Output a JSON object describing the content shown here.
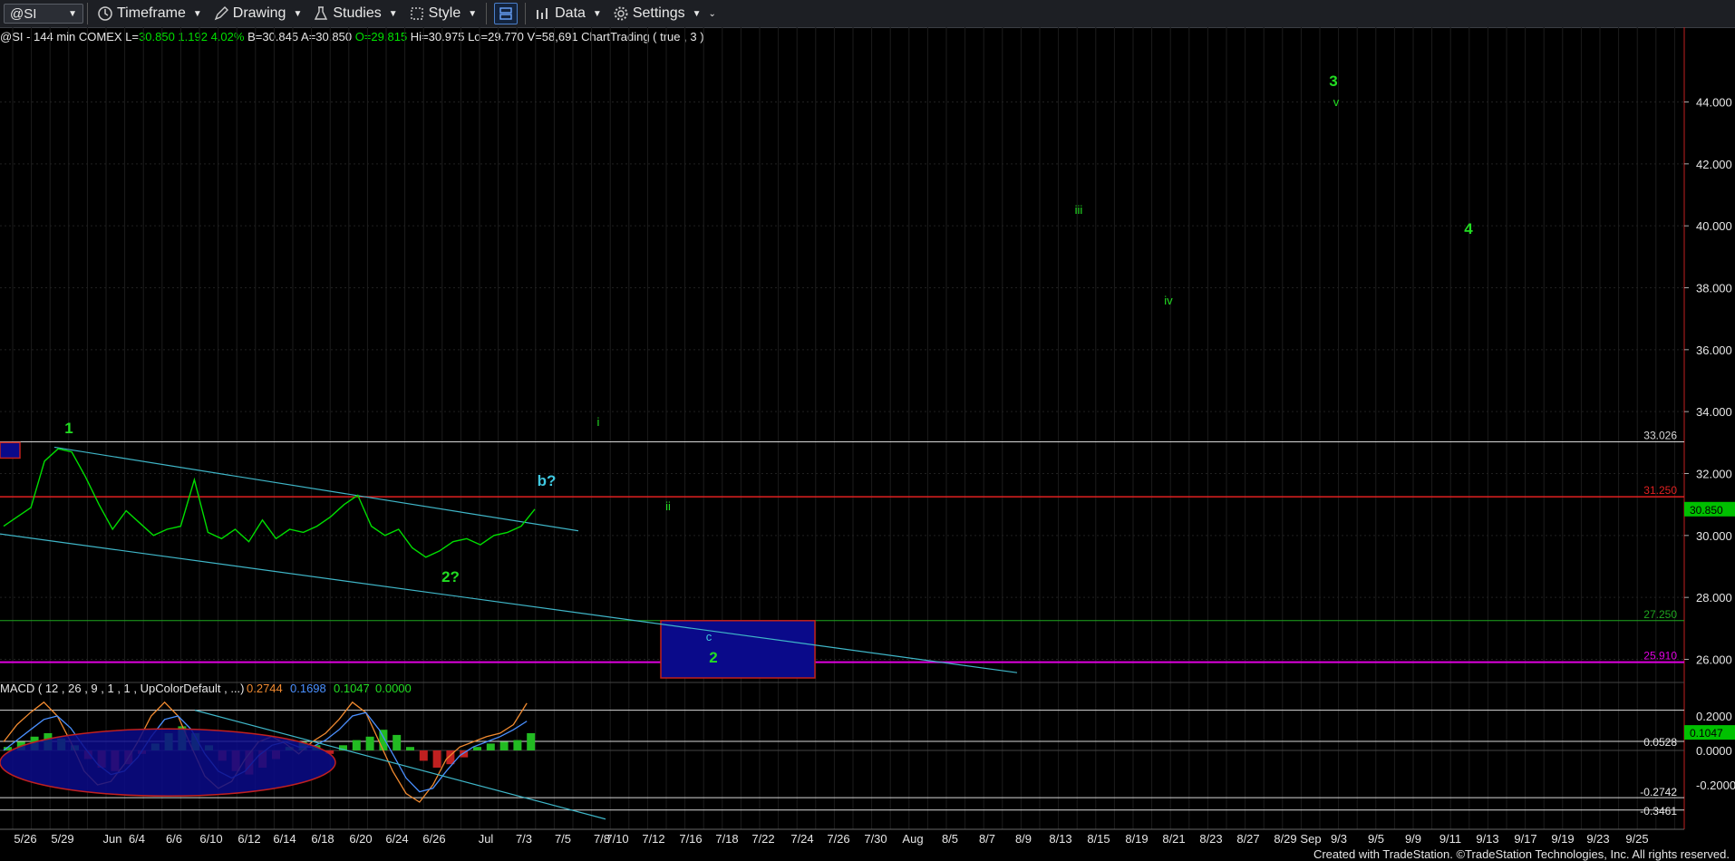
{
  "toolbar": {
    "symbol": "@SI",
    "timeframe": "Timeframe",
    "drawing": "Drawing",
    "studies": "Studies",
    "style": "Style",
    "data": "Data",
    "settings": "Settings"
  },
  "infobar": {
    "symbol_desc": "@SI - 144 min COMEX",
    "last_label": "L=",
    "last_value": "30.850",
    "change": "1.192",
    "change_pct": "4.02%",
    "bid_label": "B=",
    "bid_value": "30.845",
    "ask_label": "A=",
    "ask_value": "30.850",
    "open_label": "O=",
    "open_value": "29.815",
    "high_label": "Hi=",
    "high_value": "30.975",
    "low_label": "Lo=",
    "low_value": "29.770",
    "volume_label": "V=",
    "volume_value": "58,691",
    "extra": "ChartTrading ( true , 3 )"
  },
  "colors": {
    "price": "#00dd00",
    "trendline": "#3fb6c8",
    "red_line": "#e02020",
    "green_line": "#1fa51f",
    "magenta_line": "#e000e0",
    "white_line": "#d8d8d8",
    "box_fill": "#0a0a8a",
    "box_border": "#c0201a",
    "wave_green": "#22dd22",
    "wave_cyan": "#3fc8e0"
  },
  "chart_data": {
    "type": "line",
    "y_axis_ticks": [
      "44.000",
      "42.000",
      "40.000",
      "38.000",
      "36.000",
      "34.000",
      "32.000",
      "30.000",
      "28.000",
      "26.000"
    ],
    "x_axis_ticks": [
      "5/26",
      "5/29",
      "Jun",
      "6/4",
      "6/6",
      "6/10",
      "6/12",
      "6/14",
      "6/18",
      "6/20",
      "6/24",
      "6/26",
      "Jul",
      "7/3",
      "7/5",
      "7/8",
      "7/10",
      "7/12",
      "7/16",
      "7/18",
      "7/22",
      "7/24",
      "7/26",
      "7/30",
      "Aug",
      "8/5",
      "8/7",
      "8/9",
      "8/13",
      "8/15",
      "8/19",
      "8/21",
      "8/23",
      "8/27",
      "8/29",
      "Sep",
      "9/3",
      "9/5",
      "9/9",
      "9/11",
      "9/13",
      "9/17",
      "9/19",
      "9/23",
      "9/25"
    ],
    "price_series": [
      30.3,
      30.6,
      30.9,
      32.4,
      32.8,
      32.7,
      31.9,
      31.0,
      30.2,
      30.8,
      30.4,
      30.0,
      30.2,
      30.3,
      31.8,
      30.1,
      29.9,
      30.2,
      29.8,
      30.5,
      29.9,
      30.2,
      30.1,
      30.3,
      30.6,
      31.0,
      31.3,
      30.3,
      30.0,
      30.2,
      29.6,
      29.3,
      29.5,
      29.8,
      29.9,
      29.7,
      30.0,
      30.1,
      30.3,
      30.85
    ],
    "horizontal_levels": [
      {
        "value": 33.026,
        "label": "33.026"
      },
      {
        "value": 31.25,
        "label": "31.250"
      },
      {
        "value": 27.25,
        "label": "27.250"
      },
      {
        "value": 25.91,
        "label": "25.910"
      }
    ],
    "last_price_marker": "30.850",
    "wave_labels": [
      {
        "text": "1",
        "date": "5/29",
        "price": 33.1
      },
      {
        "text": "2?",
        "date": "6/28",
        "price": 28.2
      },
      {
        "text": "b?",
        "date": "7/3",
        "price": 31.4
      },
      {
        "text": "i",
        "date": "7/7",
        "price": 33.9
      },
      {
        "text": "ii",
        "date": "7/14",
        "price": 30.6
      },
      {
        "text": "c",
        "date": "7/20",
        "price": 26.8
      },
      {
        "text": "2",
        "date": "7/20",
        "price": 26.0
      },
      {
        "text": "iii",
        "date": "8/14",
        "price": 40.5
      },
      {
        "text": "iv",
        "date": "8/21",
        "price": 37.5
      },
      {
        "text": "3",
        "date": "9/2",
        "price": 44.9
      },
      {
        "text": "v",
        "date": "9/2",
        "price": 44.0
      },
      {
        "text": "4",
        "date": "9/12",
        "price": 39.8
      }
    ],
    "target_box": {
      "from": "7/13",
      "to": "7/25",
      "high": 27.25,
      "low": 25.4
    }
  },
  "macd": {
    "title": "MACD ( 12 , 26 , 9 , 1 , 1 , UpColorDefault , ...)",
    "v1": "0.2744",
    "v2": "0.1698",
    "v3": "0.1047",
    "v4": "0.0000",
    "y_ticks": [
      "0.2000",
      "0.0000",
      "-0.2000"
    ],
    "levels": [
      "0.0528",
      "-0.2742",
      "-0.3461"
    ],
    "last_marker": "0.1047"
  },
  "footer": "Created with TradeStation. ©TradeStation Technologies, Inc. All rights reserved."
}
